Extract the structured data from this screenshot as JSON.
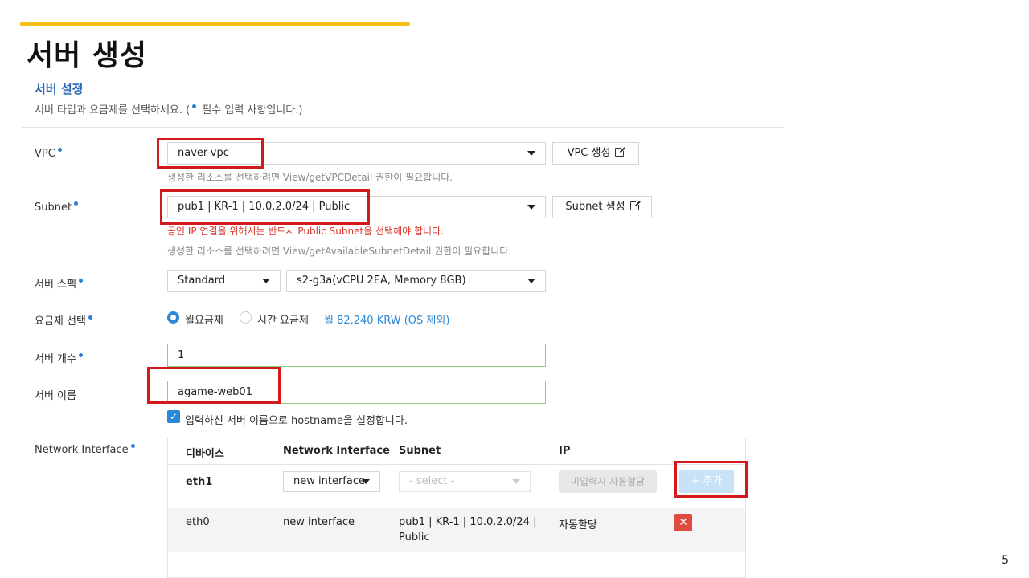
{
  "slide": {
    "title": "서버 생성",
    "page_number": "5"
  },
  "section": {
    "title": "서버 설정",
    "desc_before": "서버 타입과 요금제를 선택하세요. (",
    "desc_after": " 필수 입력 사항입니다.)"
  },
  "vpc": {
    "label": "VPC",
    "value": "naver-vpc",
    "button": "VPC 생성",
    "hint": "생성한 리소스를 선택하려면 View/getVPCDetail 권한이 필요합니다."
  },
  "subnet": {
    "label": "Subnet",
    "value": "pub1 | KR-1 | 10.0.2.0/24 | Public",
    "button": "Subnet 생성",
    "error": "공인 IP 연결을 위해서는 반드시 Public Subnet을 선택해야 합니다.",
    "hint": "생성한 리소스를 선택하려면 View/getAvailableSubnetDetail 권한이 필요합니다."
  },
  "spec": {
    "label": "서버 스펙",
    "type": "Standard",
    "value": "s2-g3a(vCPU 2EA, Memory 8GB)"
  },
  "pricing": {
    "label": "요금제 선택",
    "monthly": "월요금제",
    "hourly": "시간 요금제",
    "price": "월 82,240 KRW (OS 제외)"
  },
  "count": {
    "label": "서버 개수",
    "value": "1"
  },
  "name": {
    "label": "서버 이름",
    "value": "agame-web01",
    "checkbox_label": "입력하신 서버 이름으로 hostname을 설정합니다."
  },
  "network_interface": {
    "label": "Network Interface",
    "headers": [
      "디바이스",
      "Network Interface",
      "Subnet",
      "IP"
    ],
    "new_row": {
      "device": "eth1",
      "interface": "new interface",
      "subnet_placeholder": "- select -",
      "ip_button": "미입력시 자동할당",
      "add_button": "+ 추가"
    },
    "rows": [
      {
        "device": "eth0",
        "interface": "new interface",
        "subnet_line1": "pub1 | KR-1 | 10.0.2.0/24 |",
        "subnet_line2": "Public",
        "ip": "자동할당",
        "delete_icon": "✕"
      }
    ]
  },
  "colors": {
    "accent": "#f7c217",
    "primary": "#2a88d8",
    "highlight": "#d2191d",
    "error": "#d9362b"
  }
}
